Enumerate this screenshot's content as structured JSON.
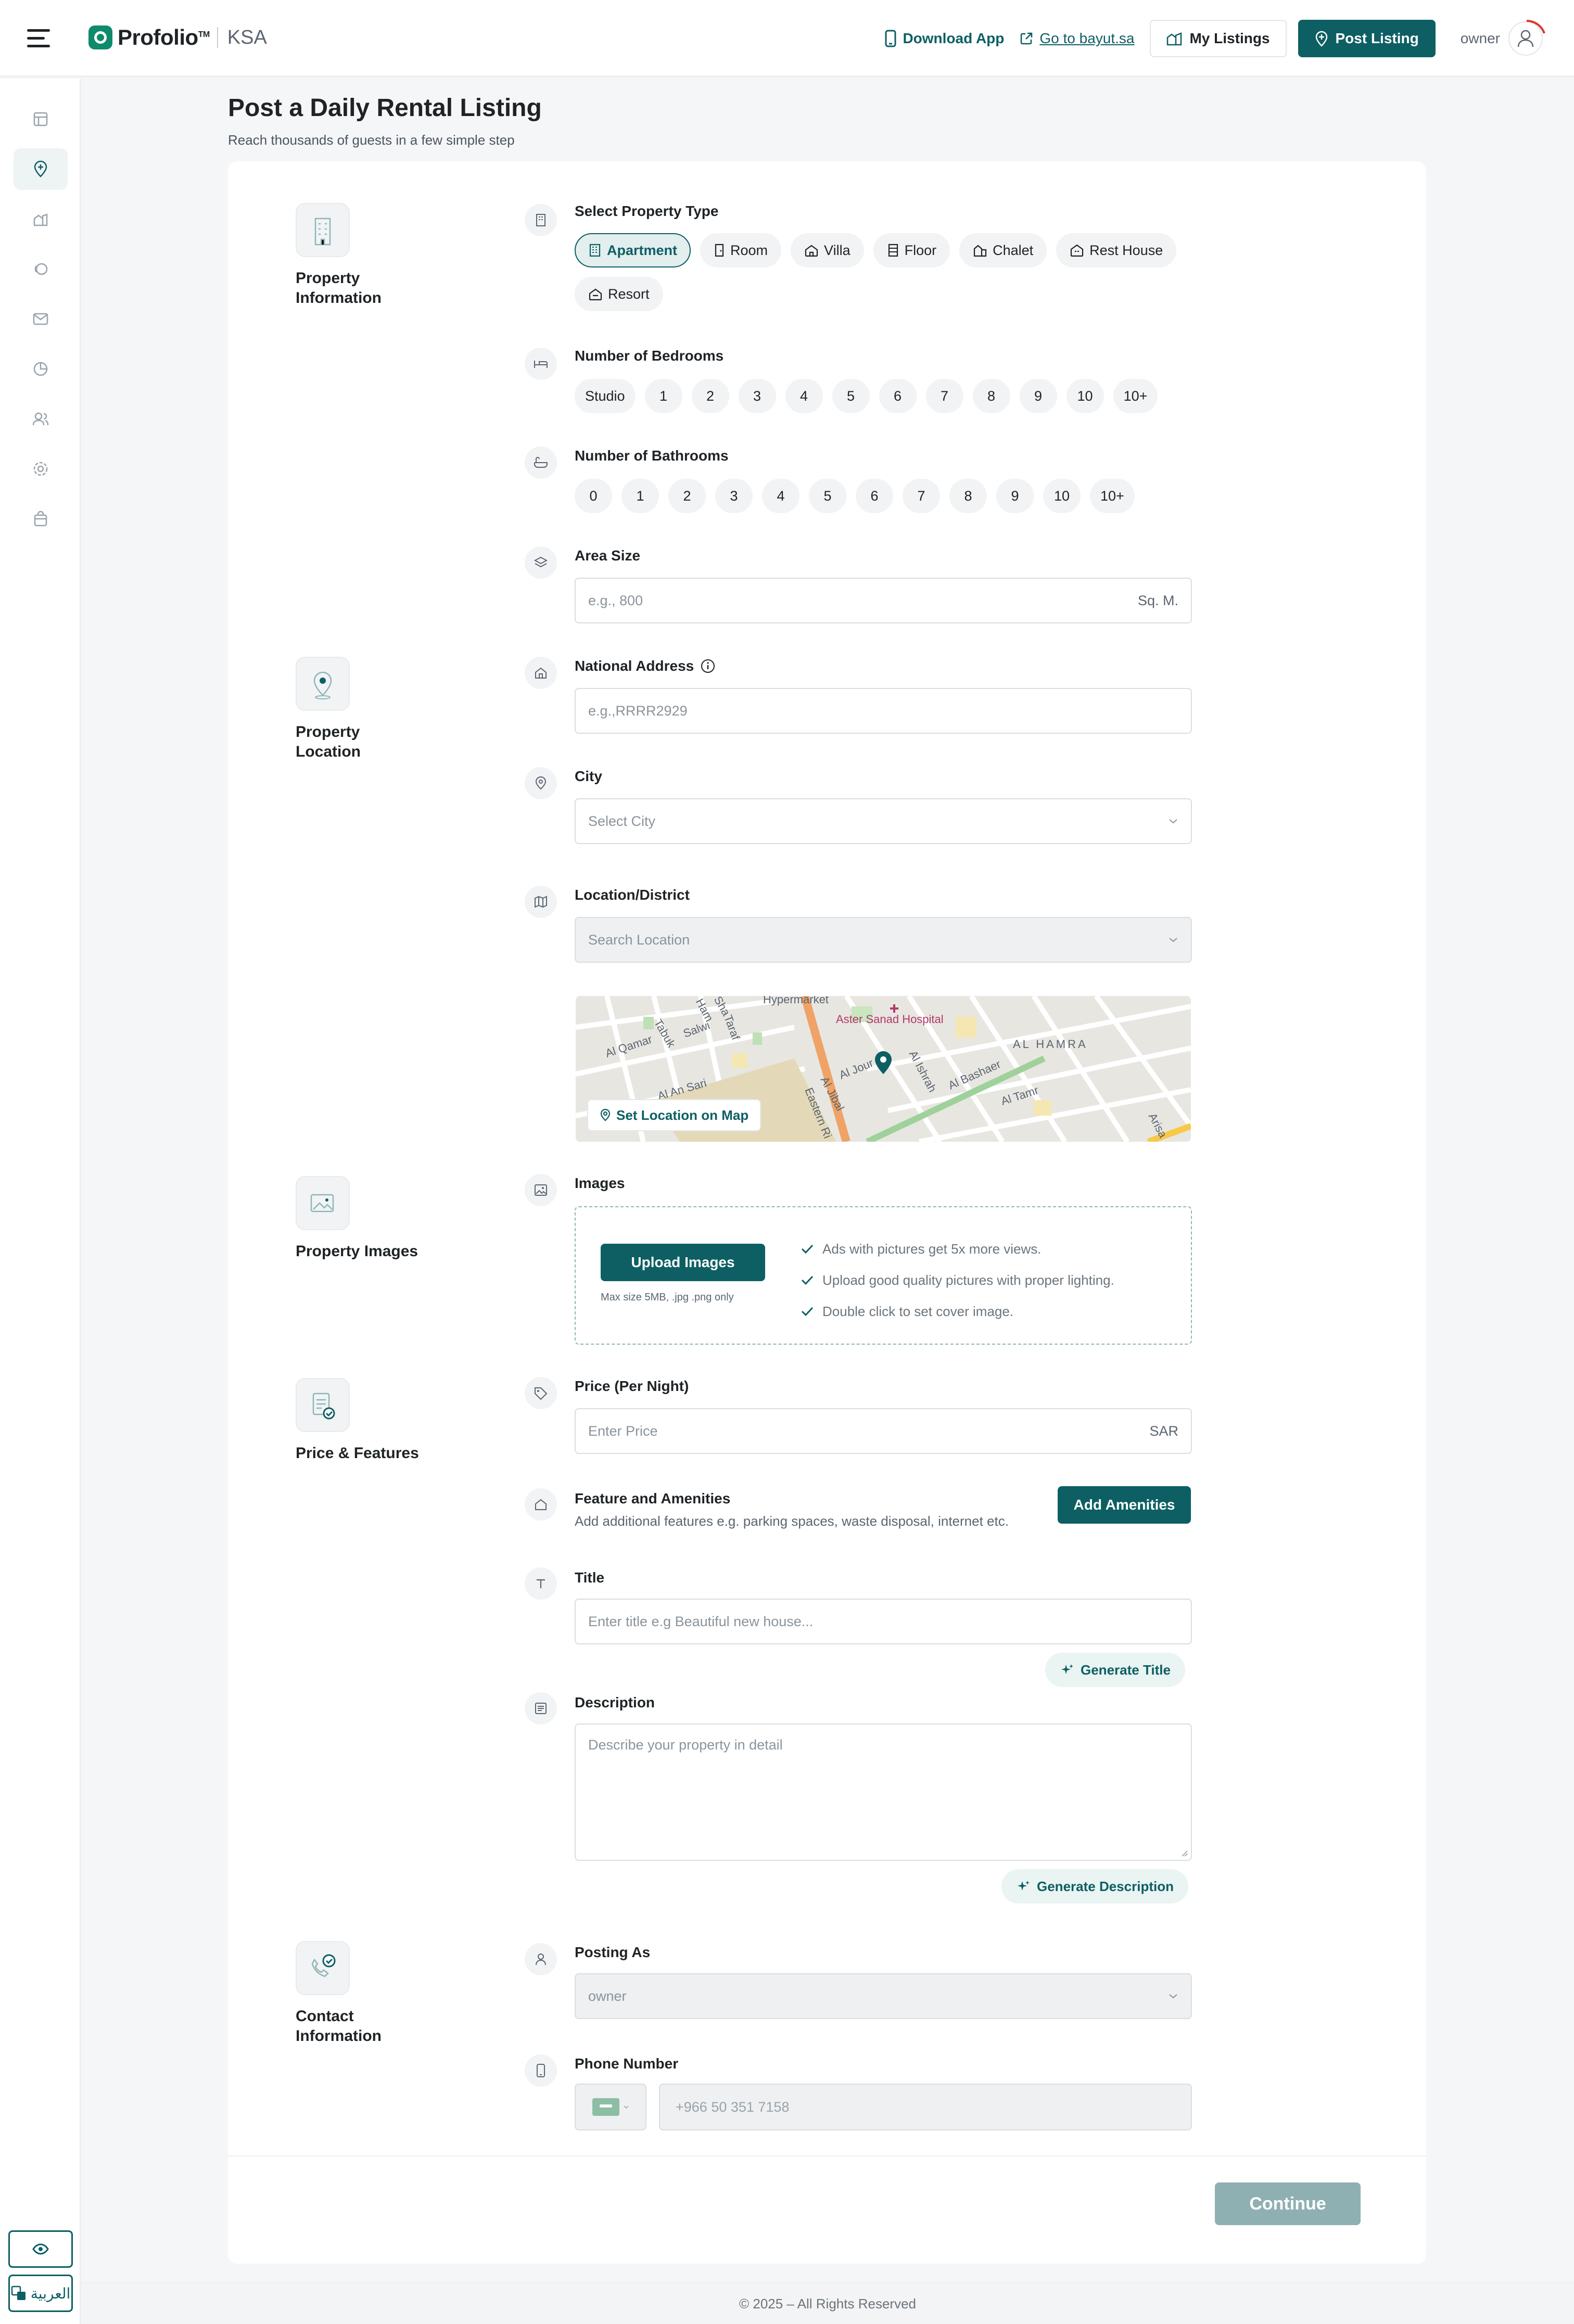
{
  "header": {
    "logo_text": "Profolio",
    "logo_tm": "TM",
    "country": "KSA",
    "download_app": "Download App",
    "go_to_bayut": "Go to bayut.sa",
    "my_listings": "My Listings",
    "post_listing": "Post Listing",
    "user_name": "owner"
  },
  "sidebar": {
    "items": [
      "dashboard-icon",
      "post-listing-icon",
      "listings-icon",
      "leads-icon",
      "messages-icon",
      "analytics-icon",
      "users-icon",
      "settings-icon",
      "bag-icon"
    ],
    "active_index": 1,
    "language_label": "العربية"
  },
  "page": {
    "title": "Post a Daily Rental Listing",
    "subtitle": "Reach thousands of guests in a few simple step"
  },
  "sections": {
    "property_information": "Property Information",
    "property_location": "Property Location",
    "property_images": "Property Images",
    "price_features": "Price & Features",
    "contact_information": "Contact Information"
  },
  "property_type": {
    "label": "Select Property Type",
    "options": [
      "Apartment",
      "Room",
      "Villa",
      "Floor",
      "Chalet",
      "Rest House",
      "Resort"
    ],
    "selected": "Apartment"
  },
  "bedrooms": {
    "label": "Number of Bedrooms",
    "options": [
      "Studio",
      "1",
      "2",
      "3",
      "4",
      "5",
      "6",
      "7",
      "8",
      "9",
      "10",
      "10+"
    ]
  },
  "bathrooms": {
    "label": "Number of Bathrooms",
    "options": [
      "0",
      "1",
      "2",
      "3",
      "4",
      "5",
      "6",
      "7",
      "8",
      "9",
      "10",
      "10+"
    ]
  },
  "area": {
    "label": "Area Size",
    "placeholder": "e.g., 800",
    "unit": "Sq. M."
  },
  "national_address": {
    "label": "National Address",
    "placeholder": "e.g.,RRRR2929"
  },
  "city": {
    "label": "City",
    "placeholder": "Select City"
  },
  "district": {
    "label": "Location/District",
    "placeholder": "Search Location"
  },
  "map": {
    "set_location": "Set Location on Map",
    "labels": [
      "Hypermarket",
      "Aster Sanad Hospital",
      "AL HAMRA",
      "Al Qamar",
      "Tabuk",
      "Salwi",
      "Taraf",
      "Al An Sari",
      "Al Jour",
      "Al Ishrah",
      "Al Bashaer",
      "Al Tamr",
      "Al Jibal",
      "Eastern Ri",
      "Arisa",
      "Sha",
      "Ham"
    ]
  },
  "images": {
    "label": "Images",
    "upload_button": "Upload Images",
    "note": "Max size 5MB, .jpg .png only",
    "tips": [
      "Ads with pictures get 5x more views.",
      "Upload good quality pictures with proper lighting.",
      "Double click to set cover image."
    ]
  },
  "price": {
    "label": "Price (Per Night)",
    "placeholder": "Enter Price",
    "currency": "SAR"
  },
  "amenities": {
    "label": "Feature and Amenities",
    "help": "Add additional features e.g. parking spaces, waste disposal, internet etc.",
    "button": "Add Amenities"
  },
  "title_field": {
    "label": "Title",
    "placeholder": "Enter title e.g Beautiful new house...",
    "generate": "Generate Title"
  },
  "description": {
    "label": "Description",
    "placeholder": "Describe your property in detail",
    "generate": "Generate Description"
  },
  "posting_as": {
    "label": "Posting As",
    "value": "owner"
  },
  "phone": {
    "label": "Phone Number",
    "placeholder": "+966 50 351 7158"
  },
  "actions": {
    "continue": "Continue"
  },
  "footer": {
    "text": "© 2025 – All Rights Reserved"
  },
  "colors": {
    "primary": "#0d5f63",
    "accent_green": "#0f8a6c",
    "disabled_primary": "#8fb0b2"
  }
}
